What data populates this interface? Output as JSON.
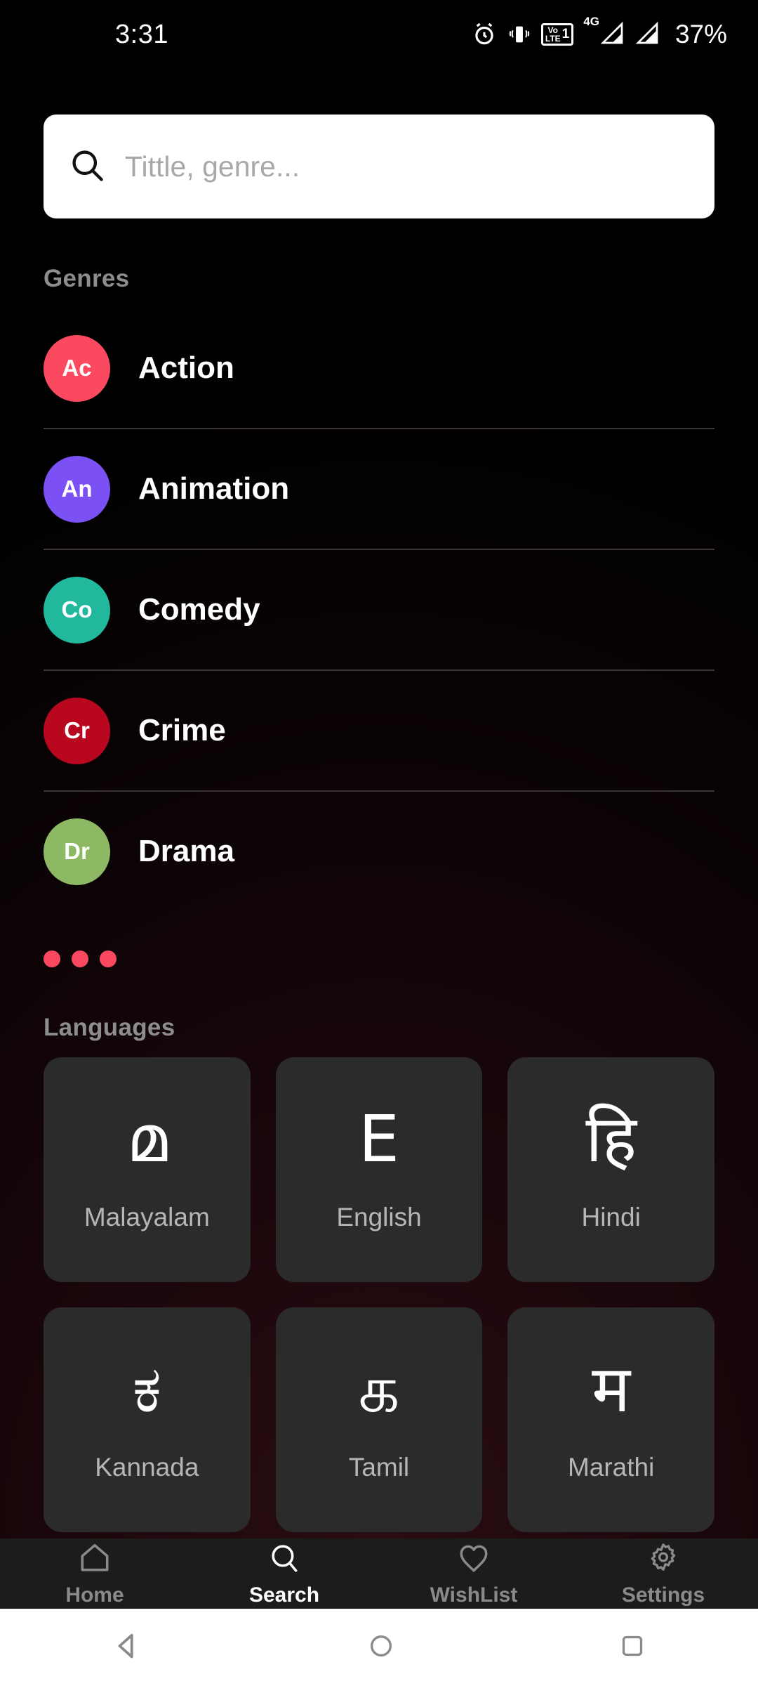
{
  "status_bar": {
    "time": "3:31",
    "battery_percent": "37%",
    "volte_label_top": "Vo",
    "volte_label_bottom": "LTE",
    "volte_sim": "1",
    "network_type": "4G",
    "icons": [
      "alarm-icon",
      "vibrate-icon",
      "volte-icon",
      "signal-icon-1",
      "signal-icon-2"
    ]
  },
  "search": {
    "placeholder": "Tittle, genre...",
    "value": "",
    "icon": "search-icon"
  },
  "genres": {
    "title": "Genres",
    "items": [
      {
        "label": "Action",
        "abbr": "Ac",
        "color": "#fb4a60"
      },
      {
        "label": "Animation",
        "abbr": "An",
        "color": "#7b50f5"
      },
      {
        "label": "Comedy",
        "abbr": "Co",
        "color": "#22b89e"
      },
      {
        "label": "Crime",
        "abbr": "Cr",
        "color": "#b8071f"
      },
      {
        "label": "Drama",
        "abbr": "Dr",
        "color": "#8db964"
      }
    ],
    "pager_dots": 3,
    "dot_color": "#fb4a60"
  },
  "languages": {
    "title": "Languages",
    "items": [
      {
        "label": "Malayalam",
        "glyph": "മ"
      },
      {
        "label": "English",
        "glyph": "E"
      },
      {
        "label": "Hindi",
        "glyph": "हि"
      },
      {
        "label": "Kannada",
        "glyph": "ಕ"
      },
      {
        "label": "Tamil",
        "glyph": "க"
      },
      {
        "label": "Marathi",
        "glyph": "म"
      }
    ]
  },
  "bottom_nav": {
    "items": [
      {
        "label": "Home",
        "icon": "home-icon",
        "active": false
      },
      {
        "label": "Search",
        "icon": "search-icon",
        "active": true
      },
      {
        "label": "WishList",
        "icon": "heart-icon",
        "active": false
      },
      {
        "label": "Settings",
        "icon": "gear-icon",
        "active": false
      }
    ]
  },
  "system_nav": {
    "back": "back-triangle-icon",
    "home": "home-circle-icon",
    "recents": "recents-square-icon"
  }
}
